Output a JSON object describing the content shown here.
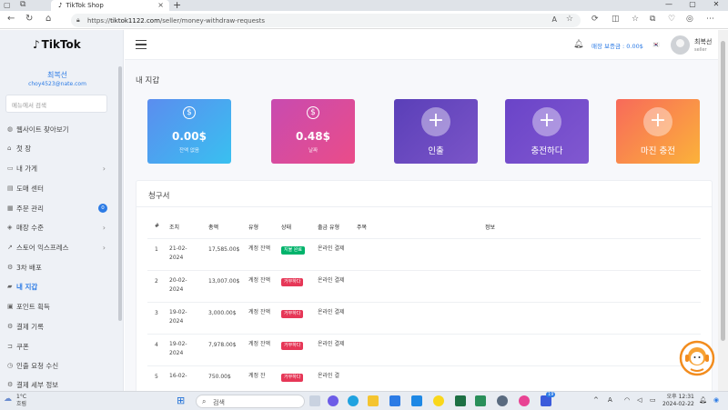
{
  "browser": {
    "tab_title": "TikTok Shop",
    "url_prefix": "https://",
    "url_host": "tiktok1122.com",
    "url_path": "/seller/money-withdraw-requests"
  },
  "sidebar": {
    "logo": "TikTok",
    "user_name": "최복선",
    "user_email": "choy4523@nate.com",
    "search_placeholder": "메뉴에서 검색",
    "items": [
      {
        "label": "웹사이트 찾아보기",
        "icon": "globe-icon"
      },
      {
        "label": "첫 장",
        "icon": "home-icon"
      },
      {
        "label": "내 가게",
        "icon": "store-icon"
      },
      {
        "label": "도매 센터",
        "icon": "wholesale-icon"
      },
      {
        "label": "주문 관리",
        "icon": "orders-icon",
        "badge": "0"
      },
      {
        "label": "매장 수준",
        "icon": "level-icon"
      },
      {
        "label": "스토어 익스프레스",
        "icon": "express-icon"
      },
      {
        "label": "3차 배포",
        "icon": "distribution-icon"
      },
      {
        "label": "내 지갑",
        "icon": "wallet-icon",
        "active": true
      },
      {
        "label": "포인트 획득",
        "icon": "points-icon"
      },
      {
        "label": "결제 기록",
        "icon": "payment-history-icon"
      },
      {
        "label": "쿠폰",
        "icon": "coupon-icon"
      },
      {
        "label": "인출 요청 수신",
        "icon": "withdraw-request-icon"
      },
      {
        "label": "결제 세부 정보",
        "icon": "payment-details-icon"
      }
    ]
  },
  "header": {
    "sales_text": "매장 보증금 : 0.00$",
    "user_name": "최복선",
    "user_role": "seller"
  },
  "main": {
    "page_title": "내 지갑",
    "cards": [
      {
        "value": "0.00$",
        "label": "잔액 없음",
        "color_from": "#5b8def",
        "color_to": "#39c0f0"
      },
      {
        "value": "0.48$",
        "label": "날짜",
        "color_from": "#c84bb0",
        "color_to": "#ea4c89"
      },
      {
        "label": "인출",
        "color_from": "#5a3fb8",
        "color_to": "#7b55c8"
      },
      {
        "label": "충전하다",
        "color_from": "#6a44c8",
        "color_to": "#8158d0"
      },
      {
        "label": "마진 충전",
        "color_from": "#f86a5a",
        "color_to": "#fbb23a"
      }
    ],
    "table_title": "청구서",
    "columns": [
      "#",
      "조치",
      "총액",
      "유형",
      "상태",
      "출금 유형",
      "주목",
      "정보"
    ],
    "rows": [
      {
        "num": "1",
        "date": "21-02-2024",
        "amount": "17,585.00$",
        "type": "계정 잔액",
        "status": "지불 완료",
        "status_kind": "ok",
        "method": "온라인 결제"
      },
      {
        "num": "2",
        "date": "20-02-2024",
        "amount": "13,007.00$",
        "type": "계정 잔액",
        "status": "거부하다",
        "status_kind": "no",
        "method": "온라인 결제"
      },
      {
        "num": "3",
        "date": "19-02-2024",
        "amount": "3,000.00$",
        "type": "계정 잔액",
        "status": "거부하다",
        "status_kind": "no",
        "method": "온라인 결제"
      },
      {
        "num": "4",
        "date": "19-02-2024",
        "amount": "7,978.00$",
        "type": "계정 잔액",
        "status": "거부하다",
        "status_kind": "no",
        "method": "온라인 결제"
      },
      {
        "num": "5",
        "date": "16-02-",
        "amount": "750.00$",
        "type": "계정 잔",
        "status": "거부하다",
        "status_kind": "no",
        "method": "온라인 결"
      }
    ]
  },
  "taskbar": {
    "weather_temp": "1°C",
    "weather_desc": "흐림",
    "search_label": "검색",
    "time_period": "오후 12:31",
    "date": "2024-02-22",
    "notification_count": "19"
  }
}
